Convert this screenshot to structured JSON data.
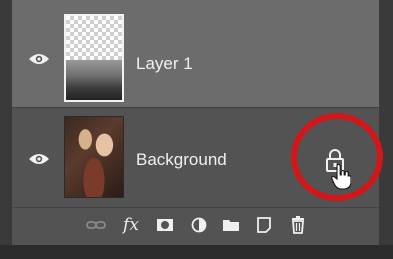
{
  "layers": [
    {
      "name": "Layer 1",
      "visible": true,
      "selected": true
    },
    {
      "name": "Background",
      "visible": true,
      "selected": false,
      "locked": true
    }
  ],
  "toolbar": {
    "icons": [
      "link-icon",
      "fx-icon",
      "mask-icon",
      "adjustment-icon",
      "folder-icon",
      "new-layer-icon",
      "trash-icon"
    ],
    "fx_label": "fx"
  },
  "colors": {
    "panel_bg": "#535353",
    "selected_row_bg": "#6c6c6c",
    "highlight_ring": "#d2171b",
    "text": "#f0f0f0"
  }
}
